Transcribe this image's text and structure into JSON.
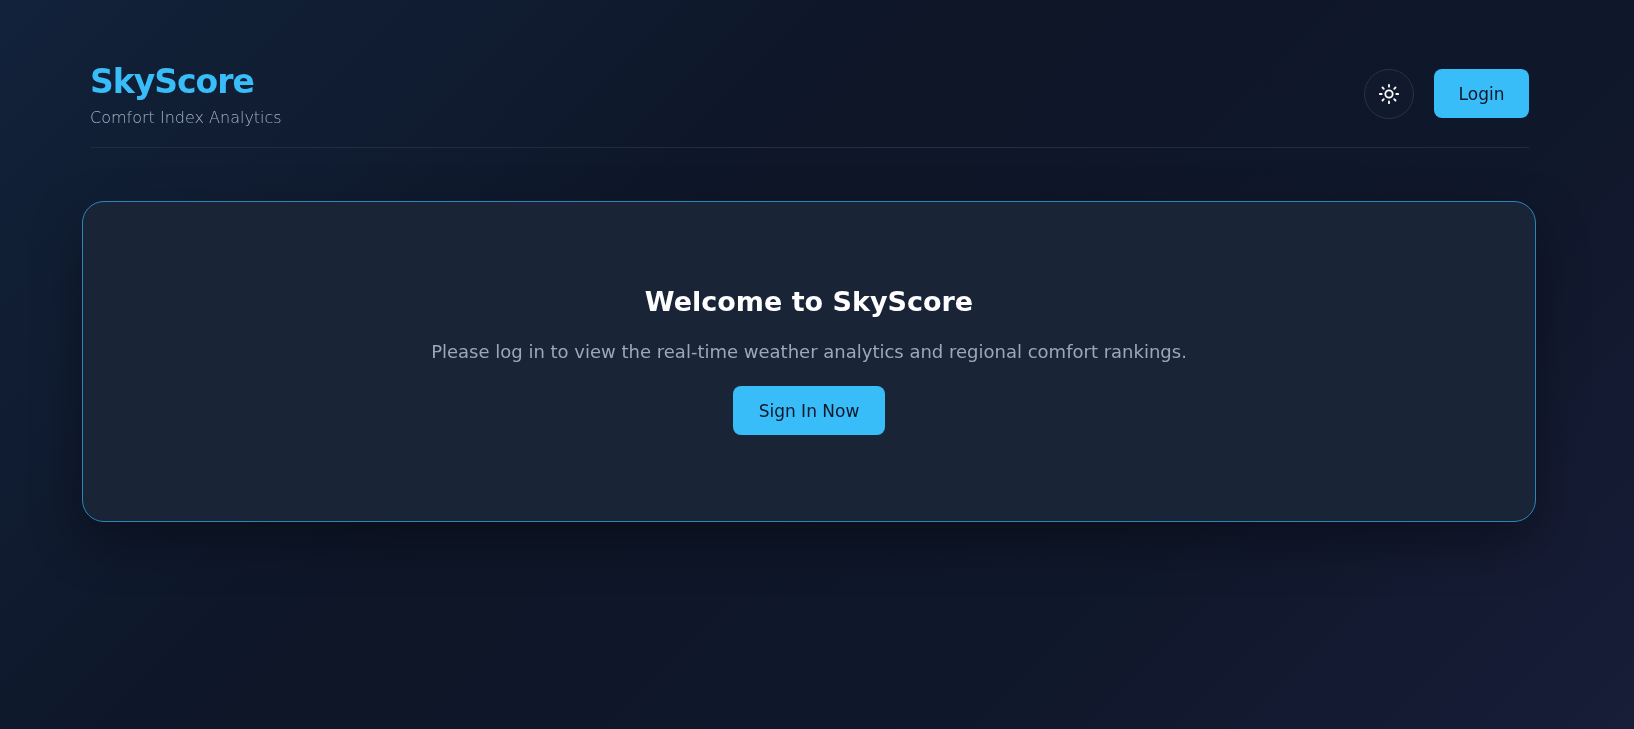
{
  "header": {
    "title": "SkyScore",
    "subtitle": "Comfort Index Analytics",
    "login_button": "Login"
  },
  "welcome": {
    "title": "Welcome to SkyScore",
    "message": "Please log in to view the real-time weather analytics and regional comfort rankings.",
    "button": "Sign In Now"
  }
}
